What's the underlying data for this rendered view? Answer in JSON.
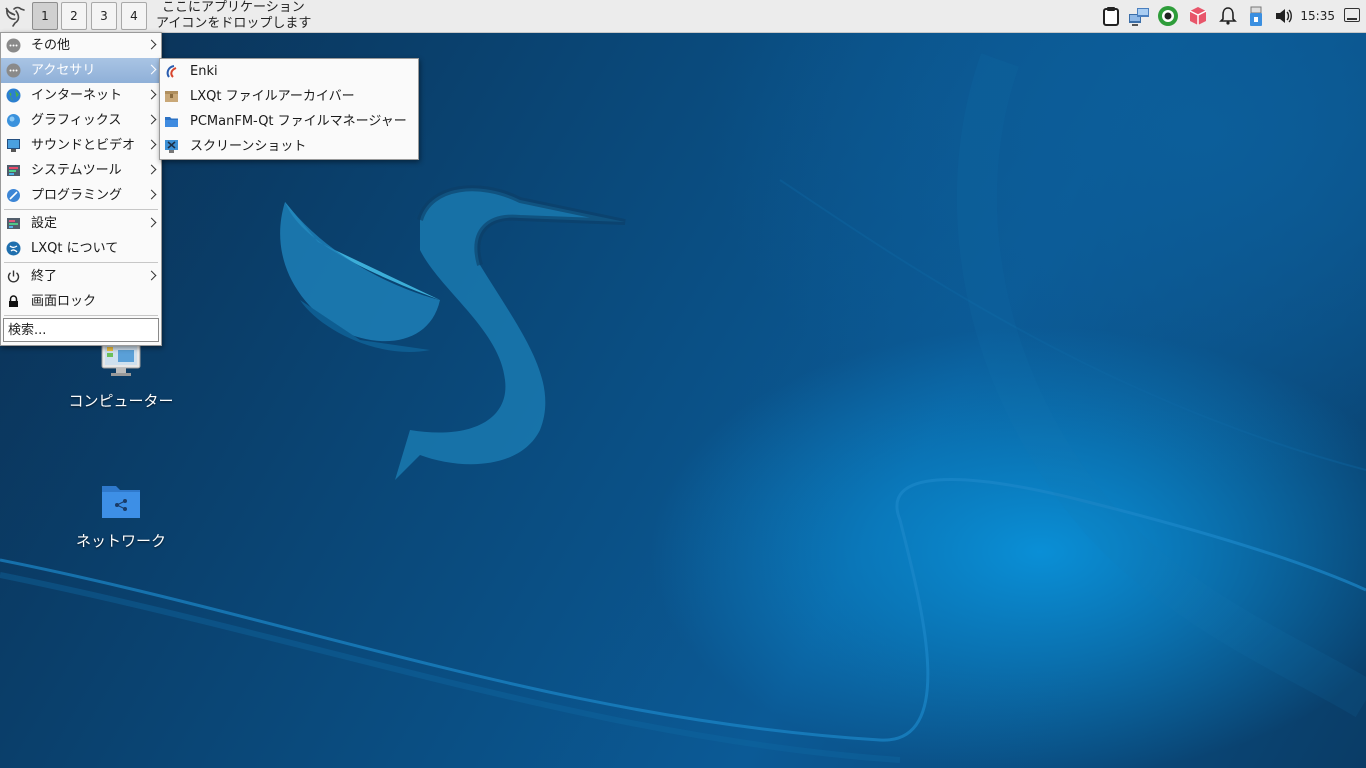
{
  "panel": {
    "workspaces": [
      "1",
      "2",
      "3",
      "4"
    ],
    "active_workspace": "1",
    "quicklaunch_line1": "ここにアプリケーション",
    "quicklaunch_line2": "アイコンをドロップします",
    "tray_icons": [
      "clipboard-icon",
      "network-icon",
      "recorder-icon",
      "package-icon",
      "notification-bell-icon",
      "usb-icon",
      "volume-icon"
    ],
    "clock": "15:35"
  },
  "main_menu": {
    "items": [
      {
        "label": "その他",
        "icon": "more-icon",
        "submenu": true
      },
      {
        "label": "アクセサリ",
        "icon": "more-icon",
        "submenu": true,
        "highlighted": true
      },
      {
        "label": "インターネット",
        "icon": "globe-icon",
        "submenu": true
      },
      {
        "label": "グラフィックス",
        "icon": "graphics-icon",
        "submenu": true
      },
      {
        "label": "サウンドとビデオ",
        "icon": "multimedia-icon",
        "submenu": true
      },
      {
        "label": "システムツール",
        "icon": "system-tools-icon",
        "submenu": true
      },
      {
        "label": "プログラミング",
        "icon": "programming-icon",
        "submenu": true
      },
      {
        "label": "設定",
        "icon": "settings-icon",
        "submenu": true
      },
      {
        "label": "LXQt について",
        "icon": "lxqt-icon",
        "submenu": false
      },
      {
        "label": "終了",
        "icon": "power-icon",
        "submenu": true
      },
      {
        "label": "画面ロック",
        "icon": "lock-icon",
        "submenu": false
      }
    ],
    "search_placeholder": "検索..."
  },
  "accessories_menu": {
    "items": [
      {
        "label": "Enki",
        "icon": "enki-icon"
      },
      {
        "label": "LXQt ファイルアーカイバー",
        "icon": "archive-icon"
      },
      {
        "label": "PCManFM-Qt ファイルマネージャー",
        "icon": "folder-icon"
      },
      {
        "label": "スクリーンショット",
        "icon": "screenshot-icon"
      }
    ]
  },
  "desktop_icons": [
    {
      "label": "コンピューター",
      "icon": "computer-icon"
    },
    {
      "label": "ネットワーク",
      "icon": "network-folder-icon"
    }
  ],
  "colors": {
    "panel_bg": "#ececec",
    "menu_highlight": "#8fb0d8",
    "wallpaper_dark": "#0b2f52",
    "wallpaper_light": "#0a8fd6"
  }
}
